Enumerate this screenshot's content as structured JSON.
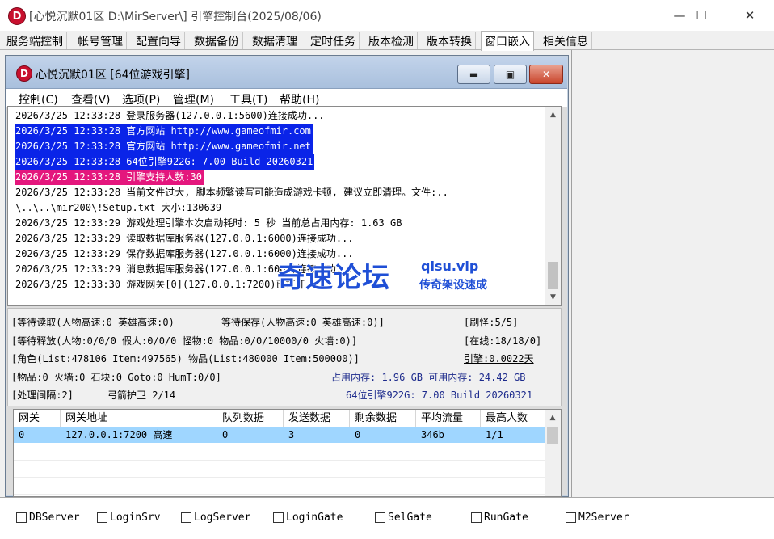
{
  "window": {
    "logo_letter": "D",
    "title": "[心悦沉默01区 D:\\MirServer\\] 引擎控制台(2025/08/06)",
    "minimize": "—",
    "maximize": "☐",
    "close": "✕"
  },
  "tabs": [
    {
      "label": "服务端控制"
    },
    {
      "label": "帐号管理"
    },
    {
      "label": "配置向导"
    },
    {
      "label": "数据备份"
    },
    {
      "label": "数据清理"
    },
    {
      "label": "定时任务"
    },
    {
      "label": "版本检测"
    },
    {
      "label": "版本转换"
    },
    {
      "label": "窗口嵌入",
      "active": true
    },
    {
      "label": "相关信息"
    }
  ],
  "inner_window": {
    "logo_letter": "D",
    "title": "心悦沉默01区 [64位游戏引擎]",
    "minimize": "▬",
    "maximize": "▣",
    "close": "✕",
    "menu": [
      "控制(C)",
      "查看(V)",
      "选项(P)",
      "管理(M)",
      "工具(T)",
      "帮助(H)"
    ]
  },
  "log": [
    {
      "text": "2026/3/25 12:33:28 登录服务器(127.0.0.1:5600)连接成功...",
      "style": "normal"
    },
    {
      "text": "2026/3/25 12:33:28 官方网站 http://www.gameofmir.com",
      "style": "blue"
    },
    {
      "text": "2026/3/25 12:33:28 官方网站 http://www.gameofmir.net",
      "style": "blue"
    },
    {
      "text": "2026/3/25 12:33:28 64位引擎922G: 7.00 Build 20260321",
      "style": "blue"
    },
    {
      "text": "2026/3/25 12:33:28 引擎支持人数:30",
      "style": "pink"
    },
    {
      "text": "2026/3/25 12:33:28 当前文件过大, 脚本频繁读写可能造成游戏卡顿, 建议立即清理。文件:..",
      "style": "normal"
    },
    {
      "text": "\\..\\..\\mir200\\!Setup.txt 大小:130639",
      "style": "normal"
    },
    {
      "text": "2026/3/25 12:33:29 游戏处理引擎本次启动耗时: 5 秒 当前总占用内存: 1.63 GB",
      "style": "normal"
    },
    {
      "text": "2026/3/25 12:33:29 读取数据库服务器(127.0.0.1:6000)连接成功...",
      "style": "normal"
    },
    {
      "text": "2026/3/25 12:33:29 保存数据库服务器(127.0.0.1:6000)连接成功...",
      "style": "normal"
    },
    {
      "text": "2026/3/25 12:33:29 消息数据库服务器(127.0.0.1:6000)连接成功...",
      "style": "normal"
    },
    {
      "text": "2026/3/25 12:33:30 游戏网关[0](127.0.0.1:7200)已打开...",
      "style": "normal"
    }
  ],
  "status": {
    "wait_read": "[等待读取(人物高速:0 英雄高速:0)",
    "wait_save": "等待保存(人物高速:0 英雄高速:0)]",
    "refresh": "[刷怪:5/5]",
    "release": "[等待释放(人物:0/0/0 假人:0/0/0 怪物:0 物品:0/0/10000/0 火墙:0)]",
    "online": "[在线:18/18/0]",
    "role_list": "[角色(List:478106 Item:497565) 物品(List:480000 Item:500000)]",
    "engine_uptime": "引擎:0.0022天",
    "items": "[物品:0 火墙:0 石块:0 Goto:0 HumT:0/0]",
    "memory": "占用内存: 1.96 GB 可用内存: 24.42 GB",
    "interval": "[处理间隔:2]",
    "archer": "弓箭护卫 2/14",
    "engine_build": "64位引擎922G: 7.00 Build 20260321"
  },
  "gateway_table": {
    "columns": [
      "网关",
      "网关地址",
      "队列数据",
      "发送数据",
      "剩余数据",
      "平均流量",
      "最高人数"
    ],
    "rows": [
      [
        "0",
        "127.0.0.1:7200 高速",
        "0",
        "3",
        "0",
        "346b",
        "1/1"
      ]
    ]
  },
  "services": [
    {
      "label": "DBServer",
      "checked": false
    },
    {
      "label": "LoginSrv",
      "checked": false
    },
    {
      "label": "LogServer",
      "checked": false
    },
    {
      "label": "LoginGate",
      "checked": false
    },
    {
      "label": "SelGate",
      "checked": false
    },
    {
      "label": "RunGate",
      "checked": false
    },
    {
      "label": "M2Server",
      "checked": false
    }
  ],
  "watermark": {
    "brand": "奇速论坛",
    "url": "qisu.vip",
    "slogan": "传奇架设速成"
  },
  "colors": {
    "log_highlight_blue": "#0a24e8",
    "log_highlight_pink": "#e4167d",
    "selected_row": "#9fd6ff",
    "status_navy": "#1c2a8c",
    "logo_red": "#c8102e"
  }
}
